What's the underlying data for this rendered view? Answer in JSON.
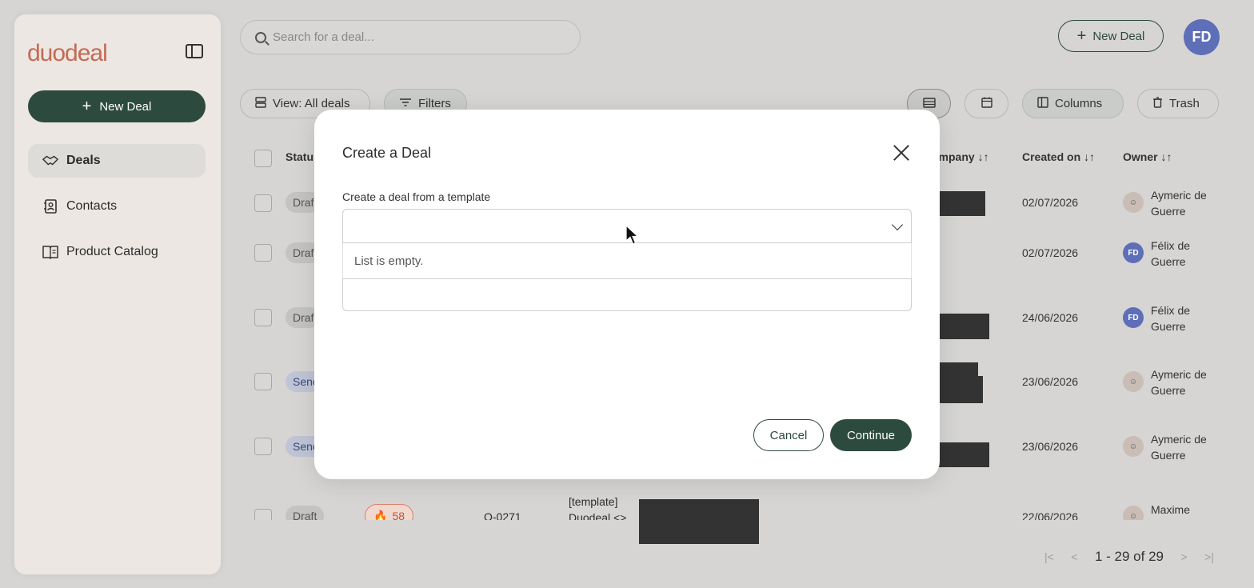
{
  "app": {
    "logo_text": "duodeal"
  },
  "sidebar": {
    "new_deal_label": "New Deal",
    "items": [
      {
        "label": "Deals",
        "icon": "handshake-icon",
        "active": true
      },
      {
        "label": "Contacts",
        "icon": "contact-book-icon",
        "active": false
      },
      {
        "label": "Product Catalog",
        "icon": "catalog-book-icon",
        "active": false
      }
    ]
  },
  "header": {
    "search_placeholder": "Search for a deal...",
    "new_deal_label": "New Deal",
    "avatar_initials": "FD"
  },
  "toolbar": {
    "view_label": "View: All deals",
    "filters_label": "Filters",
    "columns_label": "Columns",
    "trash_label": "Trash"
  },
  "table": {
    "headers": {
      "status": "Statu",
      "company": "ompany ↓↑",
      "created_on": "Created on ↓↑",
      "owner": "Owner ↓↑"
    },
    "rows": [
      {
        "status": "Draf",
        "date": "02/07/2026",
        "owner": "Aymeric de Guerre",
        "owner_initials": ""
      },
      {
        "status": "Draf",
        "date": "02/07/2026",
        "owner": "Félix de Guerre",
        "owner_initials": "FD"
      },
      {
        "status": "Draf",
        "date": "24/06/2026",
        "owner": "Félix de Guerre",
        "owner_initials": "FD"
      },
      {
        "status": "Senc",
        "date": "23/06/2026",
        "owner": "Aymeric de Guerre",
        "owner_initials": ""
      },
      {
        "status": "Senc",
        "date": "23/06/2026",
        "owner": "Aymeric de Guerre",
        "owner_initials": ""
      },
      {
        "status": "Draft",
        "date": "22/06/2026",
        "owner": "Maxime",
        "owner_initials": "",
        "score": "58",
        "ref": "O-0271",
        "name": "[template] Duodeal <>"
      }
    ]
  },
  "pagination": {
    "range_label": "1 - 29 of 29"
  },
  "modal": {
    "title": "Create a Deal",
    "template_label": "Create a deal from a template",
    "select_value": "",
    "empty_list_text": "List is empty.",
    "cancel_label": "Cancel",
    "continue_label": "Continue"
  },
  "colors": {
    "brand_green": "#2d4a3f",
    "brand_logo": "#c46a55",
    "avatar_blue": "#5e6fb8"
  }
}
